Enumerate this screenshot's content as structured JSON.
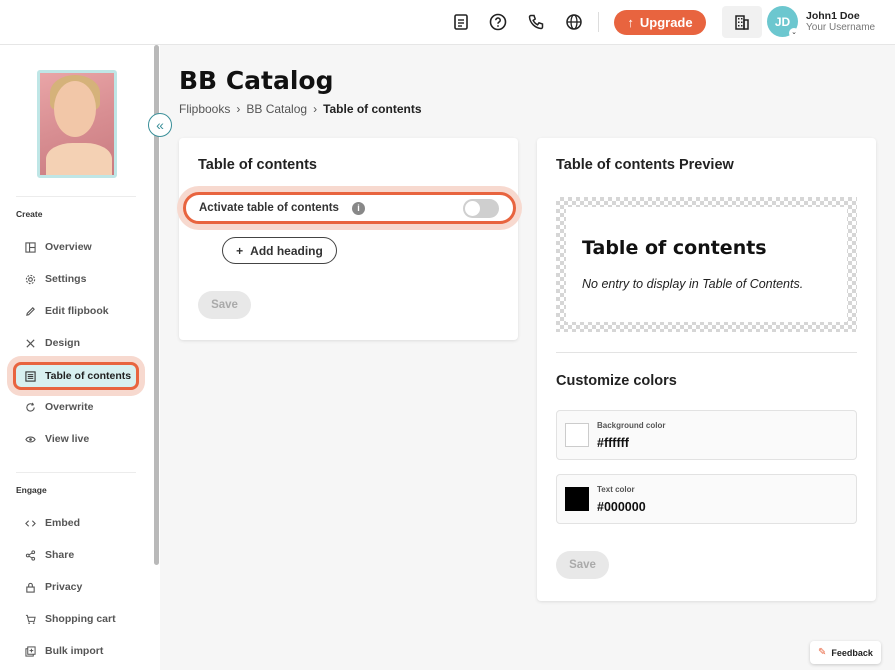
{
  "topbar": {
    "icons": [
      "document-icon",
      "help-icon",
      "phone-icon",
      "globe-icon",
      "building-icon"
    ],
    "upgrade_label": "Upgrade",
    "user": {
      "initials": "JD",
      "name": "John1 Doe",
      "subtitle": "Your Username"
    }
  },
  "sidebar": {
    "create_label": "Create",
    "create_items": [
      {
        "label": "Overview",
        "icon": "layout-icon"
      },
      {
        "label": "Settings",
        "icon": "gear-icon"
      },
      {
        "label": "Edit flipbook",
        "icon": "pencil-icon"
      },
      {
        "label": "Design",
        "icon": "tools-icon"
      },
      {
        "label": "Table of contents",
        "icon": "list-icon",
        "active": true
      },
      {
        "label": "Overwrite",
        "icon": "refresh-icon"
      },
      {
        "label": "View live",
        "icon": "eye-icon"
      }
    ],
    "engage_label": "Engage",
    "engage_items": [
      {
        "label": "Embed",
        "icon": "code-icon"
      },
      {
        "label": "Share",
        "icon": "share-icon"
      },
      {
        "label": "Privacy",
        "icon": "lock-icon"
      },
      {
        "label": "Shopping cart",
        "icon": "cart-icon"
      },
      {
        "label": "Bulk import",
        "icon": "import-icon"
      }
    ]
  },
  "page": {
    "title": "BB Catalog",
    "breadcrumb": [
      "Flipbooks",
      "BB Catalog",
      "Table of contents"
    ]
  },
  "toc_card": {
    "title": "Table of contents",
    "activate_label": "Activate table of contents",
    "activate_on": false,
    "add_heading_label": "Add heading",
    "save_label": "Save"
  },
  "preview_card": {
    "title": "Table of contents Preview",
    "preview_heading": "Table of contents",
    "preview_empty": "No entry to display in Table of Contents.",
    "customize_title": "Customize colors",
    "background_label": "Background color",
    "background_value": "#ffffff",
    "text_label": "Text color",
    "text_value": "#000000",
    "save_label": "Save"
  },
  "feedback_label": "Feedback",
  "colors": {
    "accent": "#e8643f",
    "teal": "#6cc7cf",
    "active_bg": "#d8f0f0"
  }
}
